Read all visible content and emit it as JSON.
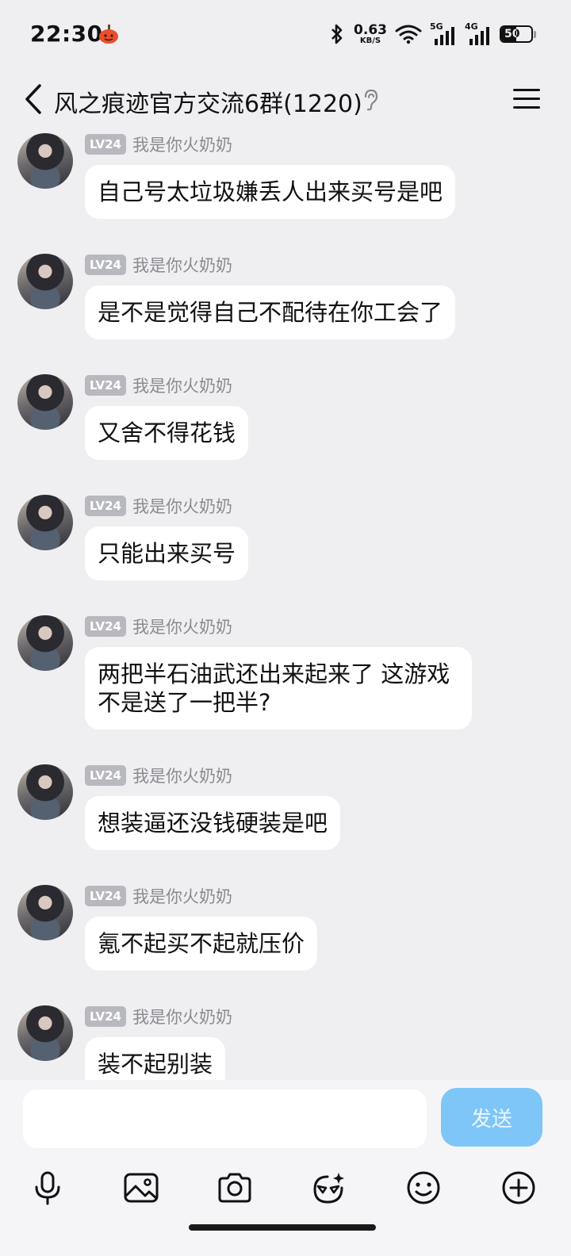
{
  "status_bar": {
    "time": "22:30",
    "net_speed_value": "0.63",
    "net_speed_unit": "KB/S",
    "signal_1_label": "5G",
    "signal_2_label": "4G",
    "battery_level": "50",
    "battery_fraction": 0.5
  },
  "header": {
    "title": "风之痕迹官方交流6群(1220)"
  },
  "messages": [
    {
      "level": "LV24",
      "nickname": "我是你火奶奶",
      "text": "自己号太垃圾嫌丢人出来买号是吧"
    },
    {
      "level": "LV24",
      "nickname": "我是你火奶奶",
      "text": "是不是觉得自己不配待在你工会了"
    },
    {
      "level": "LV24",
      "nickname": "我是你火奶奶",
      "text": "又舍不得花钱"
    },
    {
      "level": "LV24",
      "nickname": "我是你火奶奶",
      "text": "只能出来买号"
    },
    {
      "level": "LV24",
      "nickname": "我是你火奶奶",
      "text": "两把半石油武还出来起来了 这游戏不是送了一把半?"
    },
    {
      "level": "LV24",
      "nickname": "我是你火奶奶",
      "text": "想装逼还没钱硬装是吧"
    },
    {
      "level": "LV24",
      "nickname": "我是你火奶奶",
      "text": "氪不起买不起就压价"
    },
    {
      "level": "LV24",
      "nickname": "我是你火奶奶",
      "text": "装不起别装"
    }
  ],
  "input_bar": {
    "send_label": "发送",
    "send_color": "#7ec6f7",
    "tools": [
      "microphone-icon",
      "image-icon",
      "camera-icon",
      "emoji-sticker-icon",
      "smiley-icon",
      "plus-icon"
    ]
  }
}
